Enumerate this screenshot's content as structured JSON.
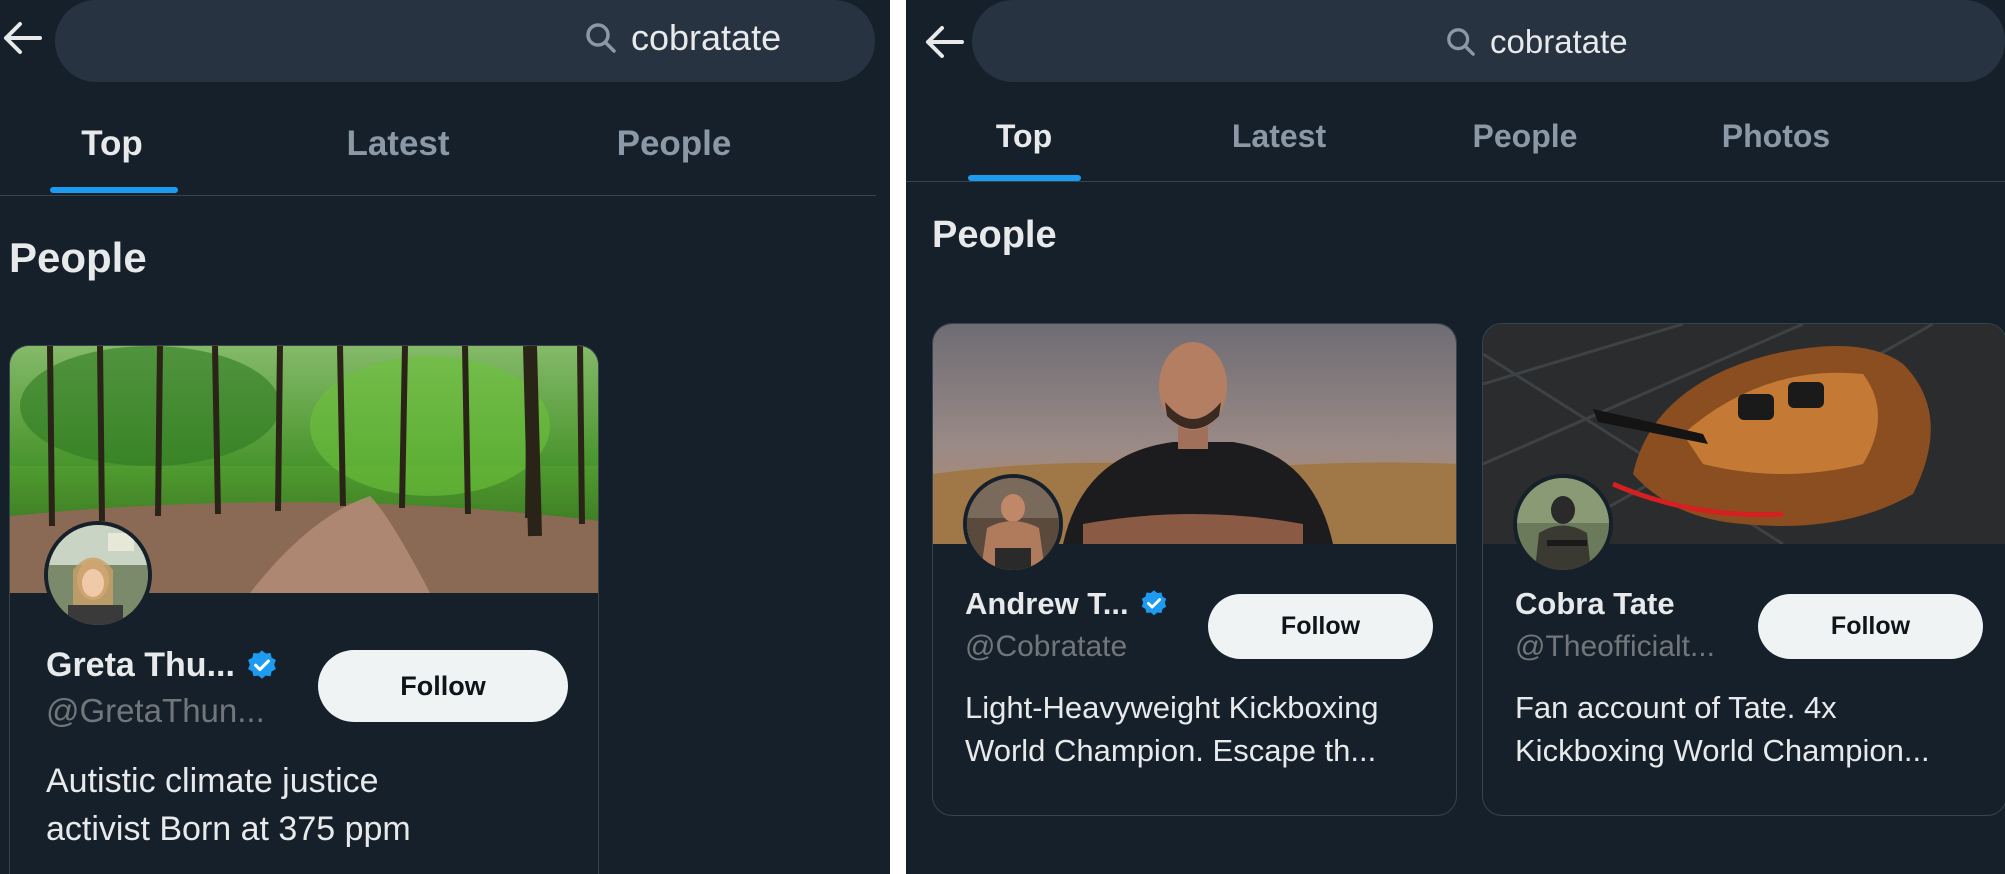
{
  "left": {
    "search": {
      "query": "cobratate"
    },
    "tabs": [
      {
        "label": "Top"
      },
      {
        "label": "Latest"
      },
      {
        "label": "People"
      }
    ],
    "section_title": "People",
    "card": {
      "name": "Greta Thu...",
      "handle": "@GretaThun...",
      "bio_lines": [
        "Autistic climate justice",
        "activist Born at 375 ppm"
      ],
      "follow_label": "Follow"
    }
  },
  "right": {
    "search": {
      "query": "cobratate"
    },
    "tabs": [
      {
        "label": "Top"
      },
      {
        "label": "Latest"
      },
      {
        "label": "People"
      },
      {
        "label": "Photos"
      }
    ],
    "section_title": "People",
    "cards": [
      {
        "name": "Andrew T...",
        "handle": "@Cobratate",
        "bio_lines": [
          "Light-Heavyweight Kickboxing",
          "World Champion. Escape th..."
        ],
        "follow_label": "Follow"
      },
      {
        "name": "Cobra Tate",
        "handle": "@Theofficialt...",
        "bio_lines": [
          "Fan account of Tate. 4x",
          "Kickboxing World Champion..."
        ],
        "follow_label": "Follow"
      }
    ]
  },
  "colors": {
    "background": "#15202b",
    "accent": "#1d9bf0",
    "text": "#e7e9ea",
    "muted": "#71767b",
    "button": "#eff3f4"
  },
  "icons": [
    "arrow-left-icon",
    "search-icon",
    "verified-badge-icon"
  ]
}
